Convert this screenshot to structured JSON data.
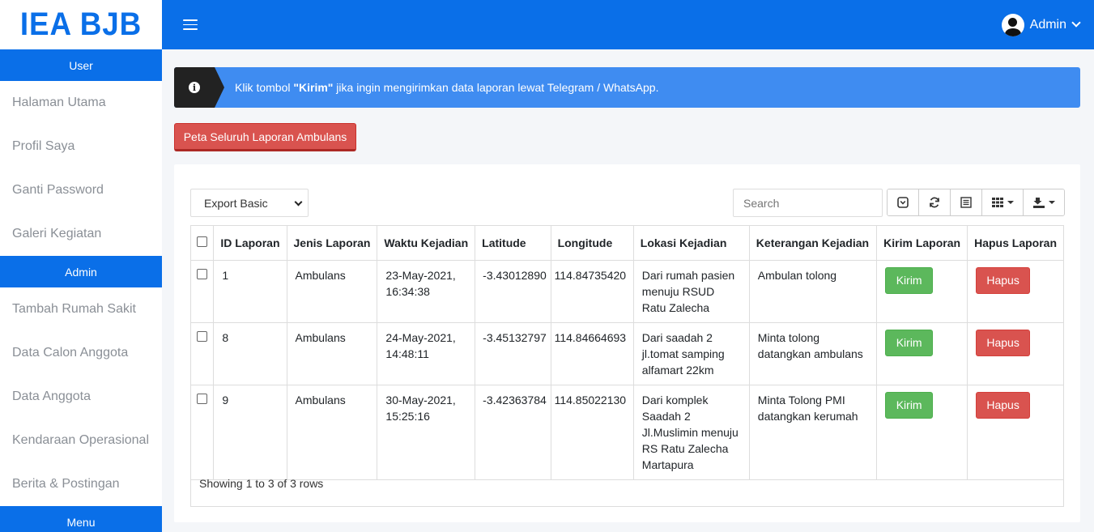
{
  "sidebar": {
    "brand": "IEA BJB",
    "sections": {
      "user": "User",
      "admin": "Admin",
      "menu": "Menu"
    },
    "user_items": [
      "Halaman Utama",
      "Profil Saya",
      "Ganti Password",
      "Galeri Kegiatan"
    ],
    "admin_items": [
      "Tambah Rumah Sakit",
      "Data Calon Anggota",
      "Data Anggota",
      "Kendaraan Operasional",
      "Berita & Postingan"
    ]
  },
  "topbar": {
    "user_label": "Admin"
  },
  "alert": {
    "prefix": "Klik tombol ",
    "bold": "\"Kirim\"",
    "suffix": " jika ingin mengirimkan data laporan lewat Telegram / WhatsApp."
  },
  "map_button": "Peta Seluruh Laporan Ambulans",
  "toolbar": {
    "export_selected": "Export Basic",
    "search_placeholder": "Search"
  },
  "table": {
    "headers": [
      "ID Laporan",
      "Jenis Laporan",
      "Waktu Kejadian",
      "Latitude",
      "Longitude",
      "Lokasi Kejadian",
      "Keterangan Kejadian",
      "Kirim Laporan",
      "Hapus Laporan"
    ],
    "rows": [
      {
        "id": "1",
        "jenis": "Ambulans",
        "waktu": "23-May-2021, 16:34:38",
        "lat": "-3.43012890",
        "lng": "114.84735420",
        "lokasi": "Dari rumah pasien menuju RSUD Ratu Zalecha",
        "keterangan": "Ambulan tolong",
        "kirim": "Kirim",
        "hapus": "Hapus"
      },
      {
        "id": "8",
        "jenis": "Ambulans",
        "waktu": "24-May-2021, 14:48:11",
        "lat": "-3.45132797",
        "lng": "114.84664693",
        "lokasi": "Dari saadah 2 jl.tomat samping alfamart 22km",
        "keterangan": "Minta tolong datangkan ambulans",
        "kirim": "Kirim",
        "hapus": "Hapus"
      },
      {
        "id": "9",
        "jenis": "Ambulans",
        "waktu": "30-May-2021, 15:25:16",
        "lat": "-3.42363784",
        "lng": "114.85022130",
        "lokasi": "Dari komplek Saadah 2 Jl.Muslimin menuju RS Ratu Zalecha Martapura",
        "keterangan": "Minta Tolong PMI datangkan kerumah",
        "kirim": "Kirim",
        "hapus": "Hapus"
      }
    ],
    "footer": "Showing 1 to 3 of 3 rows"
  },
  "colors": {
    "primary": "#0a6fe8",
    "alert": "#3f8cf1",
    "danger": "#d9534f",
    "success": "#5cb85c"
  }
}
